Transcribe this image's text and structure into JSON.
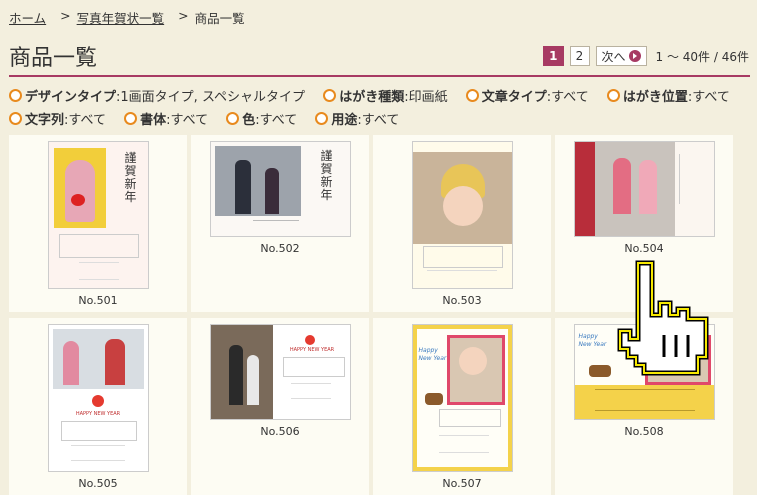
{
  "breadcrumb": {
    "home": "ホーム",
    "sep1": ">",
    "parent": "写真年賀状一覧",
    "sep2": ">",
    "current": "商品一覧"
  },
  "page": {
    "title": "商品一覧"
  },
  "pager": {
    "current": "1",
    "page2": "2",
    "next": "次へ",
    "count": "1 ～ 40件 / 46件"
  },
  "filters": [
    {
      "label": "デザインタイプ",
      "value": "1画面タイプ, スペシャルタイプ"
    },
    {
      "label": "はがき種類",
      "value": "印画紙"
    },
    {
      "label": "文章タイプ",
      "value": "すべて"
    },
    {
      "label": "はがき位置",
      "value": "すべて"
    },
    {
      "label": "文字列",
      "value": "すべて"
    },
    {
      "label": "書体",
      "value": "すべて"
    },
    {
      "label": "色",
      "value": "すべて"
    },
    {
      "label": "用途",
      "value": "すべて"
    }
  ],
  "products": [
    {
      "name": "No.501",
      "text": "謹賀新年",
      "orientation": "portrait"
    },
    {
      "name": "No.502",
      "text": "謹賀新年",
      "orientation": "landscape"
    },
    {
      "name": "No.503",
      "orientation": "portrait"
    },
    {
      "name": "No.504",
      "orientation": "landscape"
    },
    {
      "name": "No.505",
      "text": "HAPPY NEW YEAR",
      "orientation": "portrait"
    },
    {
      "name": "No.506",
      "text": "HAPPY NEW YEAR",
      "orientation": "landscape"
    },
    {
      "name": "No.507",
      "text": "Happy New Year",
      "orientation": "portrait"
    },
    {
      "name": "No.508",
      "text": "Happy New Year",
      "orientation": "landscape"
    }
  ],
  "colors": {
    "accent": "#a73a63",
    "bullet": "#e88a1e",
    "background": "#f3efde"
  }
}
